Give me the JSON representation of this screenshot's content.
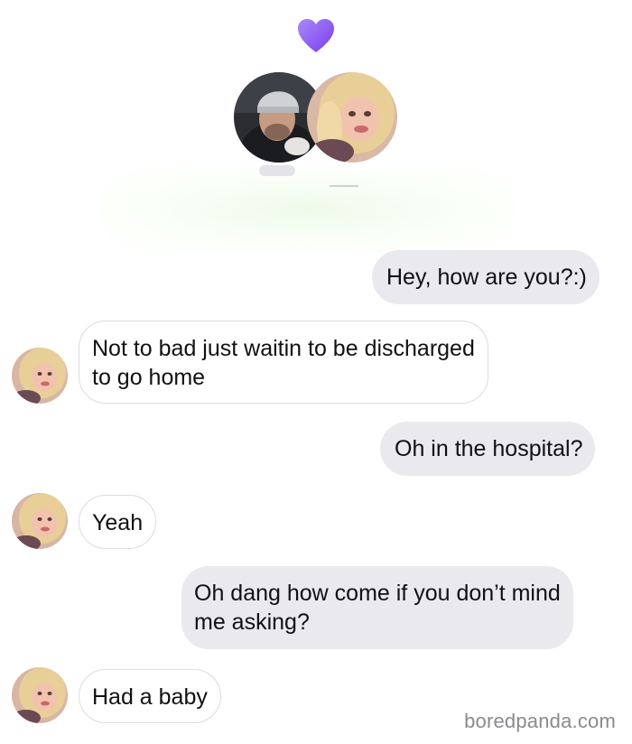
{
  "header": {
    "heart_icon": "heart-icon",
    "heart_color": "#8b5cf6",
    "participants": [
      {
        "name": "participant-man-avatar"
      },
      {
        "name": "participant-woman-avatar"
      }
    ]
  },
  "messages": [
    {
      "side": "sent",
      "lines": [
        "Hey, how are you?:)"
      ]
    },
    {
      "side": "received",
      "lines": [
        "Not to bad just waitin to be discharged",
        "to go home"
      ]
    },
    {
      "side": "sent",
      "lines": [
        "Oh in the hospital?"
      ]
    },
    {
      "side": "received",
      "lines": [
        "Yeah"
      ]
    },
    {
      "side": "sent",
      "lines": [
        "Oh dang how come if you don’t mind",
        "me asking?"
      ]
    },
    {
      "side": "received",
      "lines": [
        "Had a baby"
      ]
    }
  ],
  "colors": {
    "sent_bubble": "#e9e9ee",
    "received_border": "#dcdce2",
    "text": "#111111"
  },
  "watermark": "boredpanda.com"
}
